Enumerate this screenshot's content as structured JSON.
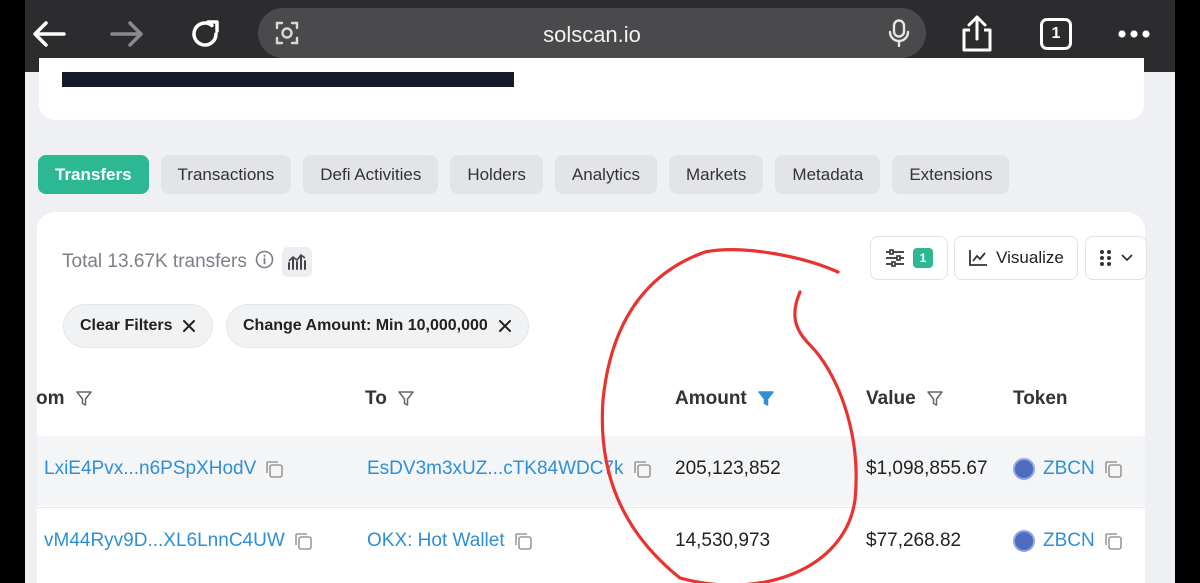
{
  "browser": {
    "url": "solscan.io",
    "tab_count": "1"
  },
  "tabs": [
    {
      "label": "Transfers"
    },
    {
      "label": "Transactions"
    },
    {
      "label": "Defi Activities"
    },
    {
      "label": "Holders"
    },
    {
      "label": "Analytics"
    },
    {
      "label": "Markets"
    },
    {
      "label": "Metadata"
    },
    {
      "label": "Extensions"
    }
  ],
  "summary": {
    "total_text": "Total 13.67K transfers"
  },
  "toolbar": {
    "filter_count": "1",
    "visualize_label": "Visualize"
  },
  "filters": {
    "clear_label": "Clear Filters",
    "active_filter": "Change Amount: Min 10,000,000"
  },
  "table": {
    "columns": {
      "from": "om",
      "to": "To",
      "amount": "Amount",
      "value": "Value",
      "token": "Token"
    },
    "rows": [
      {
        "from": "LxiE4Pvx...n6PSpXHodV",
        "to": "EsDV3m3xUZ...cTK84WDC7k",
        "amount": "205,123,852",
        "value": "$1,098,855.67",
        "token": "ZBCN"
      },
      {
        "from": "vM44Ryv9D...XL6LnnC4UW",
        "to": "OKX: Hot Wallet",
        "amount": "14,530,973",
        "value": "$77,268.82",
        "token": "ZBCN"
      }
    ]
  },
  "colors": {
    "accent": "#2bb893",
    "link": "#2f8fd6",
    "annotation": "#e8332e"
  }
}
